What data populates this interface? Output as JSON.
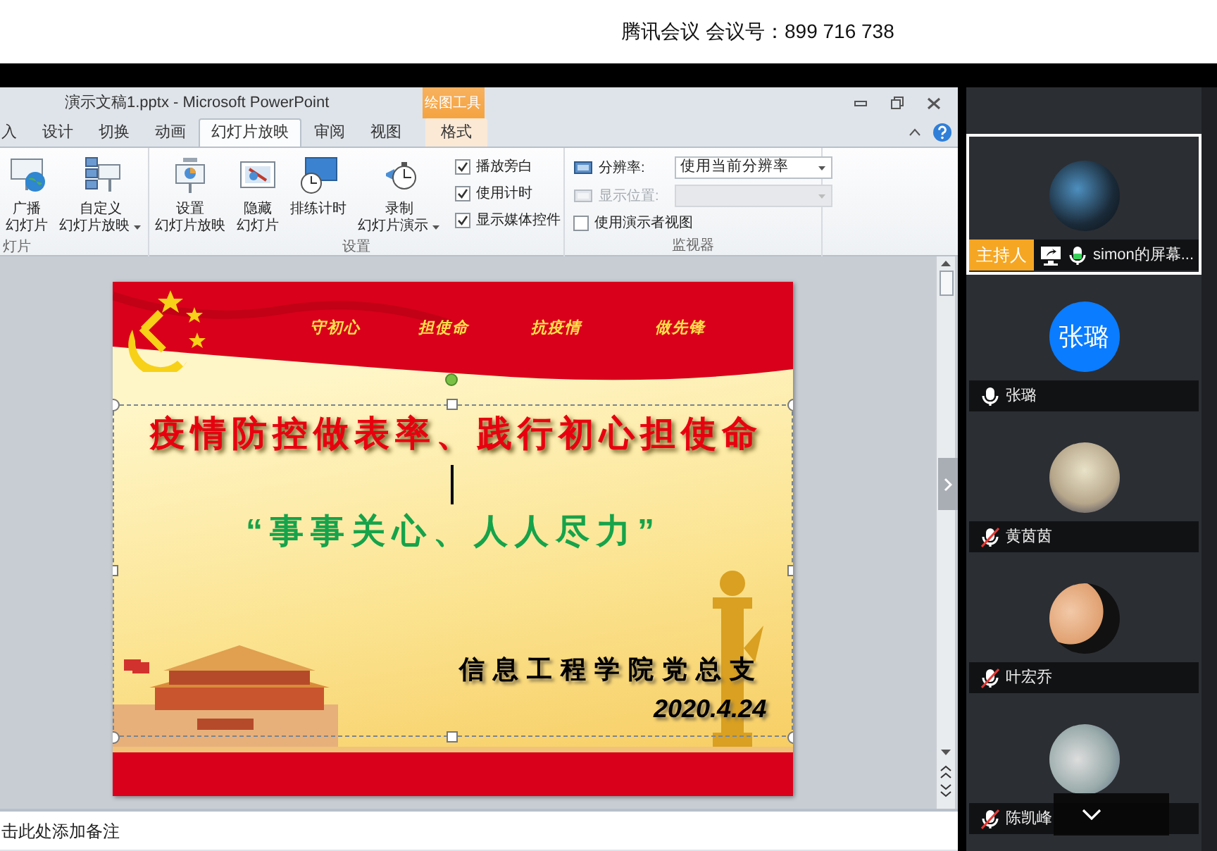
{
  "meeting_bar": {
    "app_name": "腾讯会议",
    "meeting_number": "会议号：899 716 738"
  },
  "powerpoint": {
    "title": "演示文稿1.pptx - Microsoft PowerPoint",
    "context_group": "绘图工具",
    "tabs": [
      {
        "label": "入",
        "selected": false
      },
      {
        "label": "设计",
        "selected": false
      },
      {
        "label": "切换",
        "selected": false
      },
      {
        "label": "动画",
        "selected": false
      },
      {
        "label": "幻灯片放映",
        "selected": true
      },
      {
        "label": "审阅",
        "selected": false
      },
      {
        "label": "视图",
        "selected": false
      }
    ],
    "context_tab": {
      "label": "格式",
      "selected": false
    },
    "ribbon_groups": [
      {
        "label": "灯片",
        "items": [
          {
            "kind": "large",
            "lines": [
              "广播",
              "幻灯片"
            ],
            "has_menu": false
          },
          {
            "kind": "large",
            "lines": [
              "自定义",
              "幻灯片放映"
            ],
            "has_menu": true
          }
        ]
      },
      {
        "label": "设置",
        "items": [
          {
            "kind": "large",
            "lines": [
              "设置",
              "幻灯片放映"
            ],
            "has_menu": false
          },
          {
            "kind": "large",
            "lines": [
              "隐藏",
              "幻灯片"
            ],
            "has_menu": false
          },
          {
            "kind": "large",
            "lines": [
              "排练计时"
            ],
            "has_menu": false
          },
          {
            "kind": "large",
            "lines": [
              "录制",
              "幻灯片演示"
            ],
            "has_menu": true
          },
          {
            "kind": "checkbox",
            "label": "播放旁白",
            "checked": true
          },
          {
            "kind": "checkbox",
            "label": "使用计时",
            "checked": true
          },
          {
            "kind": "checkbox",
            "label": "显示媒体控件",
            "checked": true
          }
        ]
      },
      {
        "label": "监视器",
        "items": [
          {
            "kind": "dropdown",
            "label": "分辨率:",
            "value": "使用当前分辨率",
            "disabled": false
          },
          {
            "kind": "dropdown",
            "label": "显示位置:",
            "disabled": true
          },
          {
            "kind": "checkbox",
            "label": "使用演示者视图",
            "checked": false
          }
        ]
      }
    ],
    "slide": {
      "header_words": [
        "守初心",
        "担使命",
        "抗疫情",
        "做先锋"
      ],
      "title": "疫情防控做表率、践行初心担使命",
      "quote": "“事事关心、人人尽力”",
      "organization": "信息工程学院党总支",
      "date": "2020.4.24"
    },
    "notes_placeholder": "击此处添加备注"
  },
  "participants": [
    {
      "name": "simon的屏幕...",
      "role_badge": "主持人",
      "sharing_screen": true,
      "muted": false,
      "speaking": true,
      "avatar": {
        "kind": "photo"
      },
      "selected": true
    },
    {
      "name": "张璐",
      "muted": false,
      "speaking": false,
      "avatar": {
        "kind": "initials",
        "text": "张璐"
      },
      "selected": false
    },
    {
      "name": "黄茵茵",
      "muted": true,
      "speaking": false,
      "avatar": {
        "kind": "photo"
      },
      "selected": false
    },
    {
      "name": "叶宏乔",
      "muted": true,
      "speaking": false,
      "avatar": {
        "kind": "photo"
      },
      "selected": false
    },
    {
      "name": "陈凯峰",
      "muted": true,
      "speaking": false,
      "avatar": {
        "kind": "photo"
      },
      "selected": false
    }
  ]
}
